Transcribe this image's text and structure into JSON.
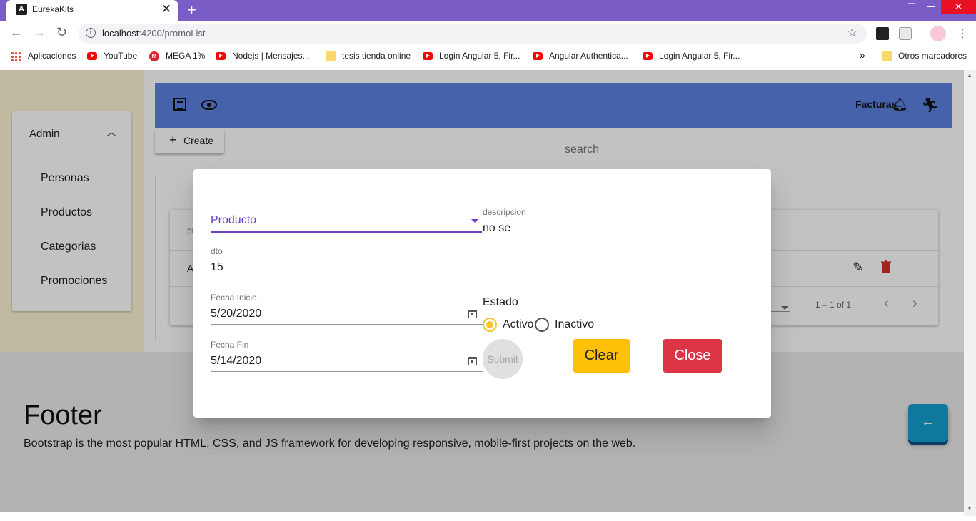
{
  "browser": {
    "tab_title": "EurekaKits",
    "tab_favicon_letter": "A",
    "url_host": "localhost",
    "url_path": ":4200/promoList",
    "bookmarks": [
      "Aplicaciones",
      "YouTube",
      "MEGA 1%",
      "Nodejs | Mensajes...",
      "tesis tienda online",
      "Login Angular 5, Fir...",
      "Angular Authentica...",
      "Login Angular 5, Fir..."
    ],
    "bookmarks_overflow": "»",
    "other_bookmarks": "Otros marcadores"
  },
  "sidebar": {
    "heading": "Admin",
    "items": [
      "Personas",
      "Productos",
      "Categorias",
      "Promociones"
    ]
  },
  "appbar": {
    "label": "Facturas"
  },
  "toolbar": {
    "create_label": "Create",
    "search_placeholder": "search"
  },
  "table": {
    "header_fragment": "pr",
    "cell_fragment": "A",
    "range_label": "1 – 1 of 1"
  },
  "footer": {
    "title": "Footer",
    "text": "Bootstrap is the most popular HTML, CSS, and JS framework for developing responsive, mobile-first projects on the web."
  },
  "dialog": {
    "producto": {
      "value": "Producto"
    },
    "descripcion": {
      "label": "descripcion",
      "value": "no se"
    },
    "dto": {
      "label": "dto",
      "value": "15"
    },
    "fecha_inicio": {
      "label": "Fecha Inicio",
      "value": "5/20/2020"
    },
    "fecha_fin": {
      "label": "Fecha Fin",
      "value": "5/14/2020"
    },
    "estado": {
      "label": "Estado",
      "options": [
        {
          "label": "Activo",
          "selected": true
        },
        {
          "label": "Inactivo",
          "selected": false
        }
      ]
    },
    "buttons": {
      "submit": "Submit",
      "clear": "Clear",
      "close": "Close"
    }
  },
  "colors": {
    "tabbar": "#7a5cc7",
    "appbar": "#5b81e0",
    "sidebar_bg": "#fdf5d6",
    "select_accent": "#6c3fc3",
    "radio_accent": "#f7c52b",
    "clear_button": "#ffc107",
    "close_button": "#dc3545",
    "fab": "#159ecf"
  },
  "icons": [
    "angular-favicon-icon",
    "close-icon",
    "plus-icon",
    "back-icon",
    "forward-icon",
    "reload-icon",
    "info-icon",
    "star-icon",
    "list-icon",
    "eye-icon",
    "bell-icon",
    "run-icon",
    "chevron-up-icon",
    "edit-icon",
    "trash-icon",
    "chevron-left-icon",
    "chevron-right-icon",
    "calendar-icon",
    "arrow-left-icon"
  ]
}
